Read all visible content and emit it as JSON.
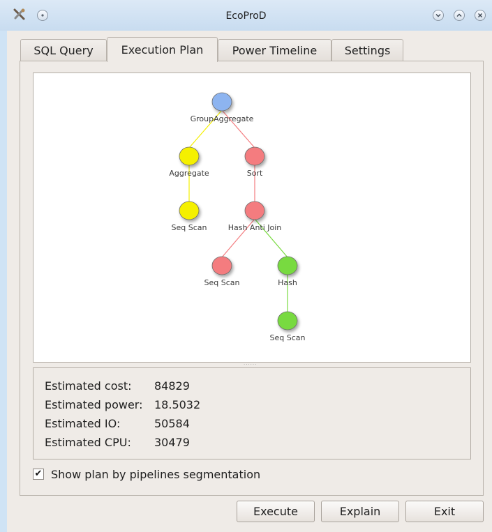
{
  "window": {
    "title": "EcoProD"
  },
  "tabs": [
    {
      "label": "SQL Query"
    },
    {
      "label": "Execution Plan"
    },
    {
      "label": "Power Timeline"
    },
    {
      "label": "Settings"
    }
  ],
  "plan": {
    "colors": {
      "blue": "#8db4f0",
      "yellow": "#f5f000",
      "red": "#f47c7f",
      "green": "#78da3f"
    },
    "nodes": [
      {
        "id": "n1",
        "label": "GroupAggregate",
        "color": "blue"
      },
      {
        "id": "n2",
        "label": "Aggregate",
        "color": "yellow"
      },
      {
        "id": "n3",
        "label": "Sort",
        "color": "red"
      },
      {
        "id": "n4",
        "label": "Seq Scan",
        "color": "yellow"
      },
      {
        "id": "n5",
        "label": "Hash Anti Join",
        "color": "red"
      },
      {
        "id": "n6",
        "label": "Seq Scan",
        "color": "red"
      },
      {
        "id": "n7",
        "label": "Hash",
        "color": "green"
      },
      {
        "id": "n8",
        "label": "Seq Scan",
        "color": "green"
      }
    ]
  },
  "stats": {
    "cost_label": "Estimated cost:",
    "cost_value": "84829",
    "power_label": "Estimated power:",
    "power_value": "18.5032",
    "io_label": "Estimated IO:",
    "io_value": "50584",
    "cpu_label": "Estimated CPU:",
    "cpu_value": "30479"
  },
  "options": {
    "show_pipelines_label": "Show plan by pipelines segmentation",
    "show_pipelines_checked": true
  },
  "buttons": {
    "execute": "Execute",
    "explain": "Explain",
    "exit": "Exit"
  }
}
